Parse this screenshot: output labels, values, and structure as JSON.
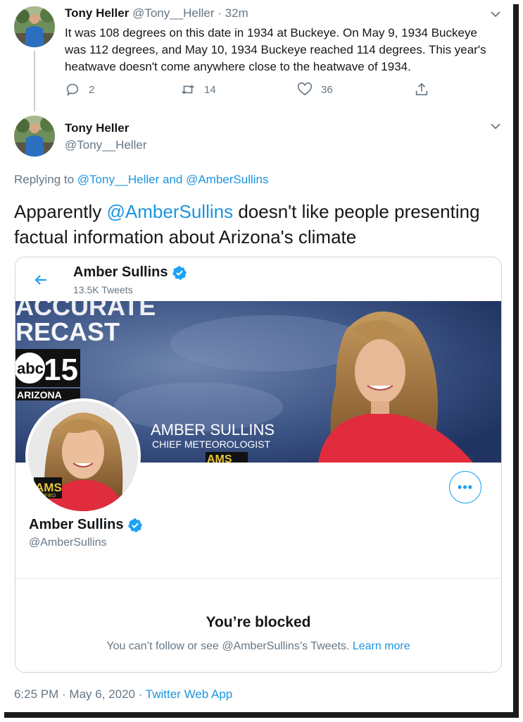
{
  "tweet1": {
    "name": "Tony Heller",
    "handle": "@Tony__Heller",
    "time": "· 32m",
    "text": "It was 108 degrees on this date in 1934 at Buckeye. On May 9, 1934 Buckeye was 112 degrees, and May 10, 1934 Buckeye reached 114 degrees. This year's heatwave doesn't come anywhere close to the heatwave of 1934.",
    "replies": "2",
    "retweets": "14",
    "likes": "36"
  },
  "tweet2": {
    "name": "Tony Heller",
    "handle": "@Tony__Heller",
    "replying_prefix": "Replying to ",
    "reply_to_1": "@Tony__Heller",
    "reply_and": " and ",
    "reply_to_2": "@AmberSullins",
    "text_before": "Apparently ",
    "text_mention": "@AmberSullins",
    "text_after": " doesn't like people presenting factual information about Arizona's climate",
    "timestamp": "6:25 PM · May 6, 2020 · ",
    "source": "Twitter Web App"
  },
  "embedded_profile": {
    "header_name": "Amber Sullins",
    "tweet_count": "13.5K Tweets",
    "banner": {
      "line1": "ACCURATE",
      "line2": "RECAST",
      "station_abc": "abc",
      "station_num": "15",
      "station_region": "ARIZONA",
      "person_name": "AMBER SULLINS",
      "person_title": "CHIEF METEOROLOGIST",
      "badge": "AMS"
    },
    "avatar_badge": "AMS",
    "avatar_badge_sub": "RTIFIED",
    "more_label": "•••",
    "name": "Amber Sullins",
    "handle": "@AmberSullins",
    "blocked_title": "You’re blocked",
    "blocked_text": "You can’t follow or see @AmberSullins’s Tweets. ",
    "learn_more": "Learn more"
  },
  "colors": {
    "link": "#1b95e0",
    "accent": "#1da1f2",
    "muted": "#657786",
    "text": "#14171a"
  },
  "icons": [
    "reply-icon",
    "retweet-icon",
    "like-icon",
    "share-icon",
    "chevron-down-icon",
    "back-arrow-icon",
    "verified-badge-icon",
    "more-options-icon"
  ]
}
